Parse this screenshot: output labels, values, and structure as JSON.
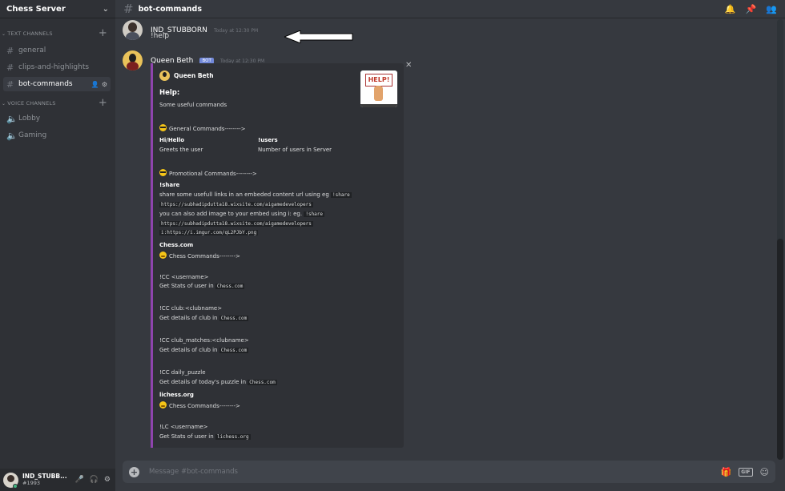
{
  "server": {
    "name": "Chess Server"
  },
  "sidebar": {
    "text_category": "TEXT CHANNELS",
    "voice_category": "VOICE CHANNELS",
    "text_channels": [
      {
        "label": "general"
      },
      {
        "label": "clips-and-highlights"
      },
      {
        "label": "bot-commands"
      }
    ],
    "voice_channels": [
      {
        "label": "Lobby"
      },
      {
        "label": "Gaming"
      }
    ]
  },
  "user": {
    "name": "IND_STUBB...",
    "tag": "#1993"
  },
  "channel": {
    "title": "bot-commands"
  },
  "messages": [
    {
      "author": "IND_STUBBORN",
      "time": "Today at 12:30 PM",
      "text": "!help"
    },
    {
      "author": "Queen Beth",
      "badge": "BOT",
      "time": "Today at 12:30 PM"
    }
  ],
  "embed": {
    "author": "Queen Beth",
    "thumbnail_text": "HELP!",
    "title": "Help:",
    "description": "Some useful commands",
    "general_header": "General Commands-------->",
    "field1_name": "Hi/Hello",
    "field1_value": "Greets the user",
    "field2_name": "!users",
    "field2_value": "Number of users in Server",
    "promo_header": "Promotional Commands-------->",
    "share_name": "!share",
    "share_line1": "share some usefull links in an embeded content url using eg",
    "share_code1": "!share",
    "share_code2": "https://subhadipdutta18.wixsite.com/aigamedevelopers",
    "share_line2": "you can also add image to your embed using i: eg.",
    "share_code3": "!share",
    "share_code4": "https://subhadipdutta18.wixsite.com/aigamedevelopers",
    "share_code5": "i:https://i.imgur.com/qL2PJbY.png",
    "chesscom_name": "Chess.com",
    "chess_header": "Chess Commands-------->",
    "cc1_cmd": "!CC <username>",
    "cc1_desc": "Get Stats of user in",
    "cc1_code": "Chess.com",
    "cc2_cmd": "!CC club:<clubname>",
    "cc2_desc": "Get details of club in",
    "cc2_code": "Chess.com",
    "cc3_cmd": "!CC club_matches:<clubname>",
    "cc3_desc": "Get details of club in",
    "cc3_code": "Chess.com",
    "cc4_cmd": "!CC daily_puzzle",
    "cc4_desc": "Get details of today's puzzle in",
    "cc4_code": "Chess.com",
    "lichess_name": "lichess.org",
    "lichess_header": "Chess Commands-------->",
    "lc1_cmd": "!LC <username>",
    "lc1_desc": "Get Stats of user in",
    "lc1_code": "lichess.org"
  },
  "composer": {
    "placeholder": "Message #bot-commands",
    "gif": "GIF"
  },
  "colors": {
    "accent": "#7289da",
    "embed_bar": "#8e44ad",
    "online": "#43b581"
  }
}
